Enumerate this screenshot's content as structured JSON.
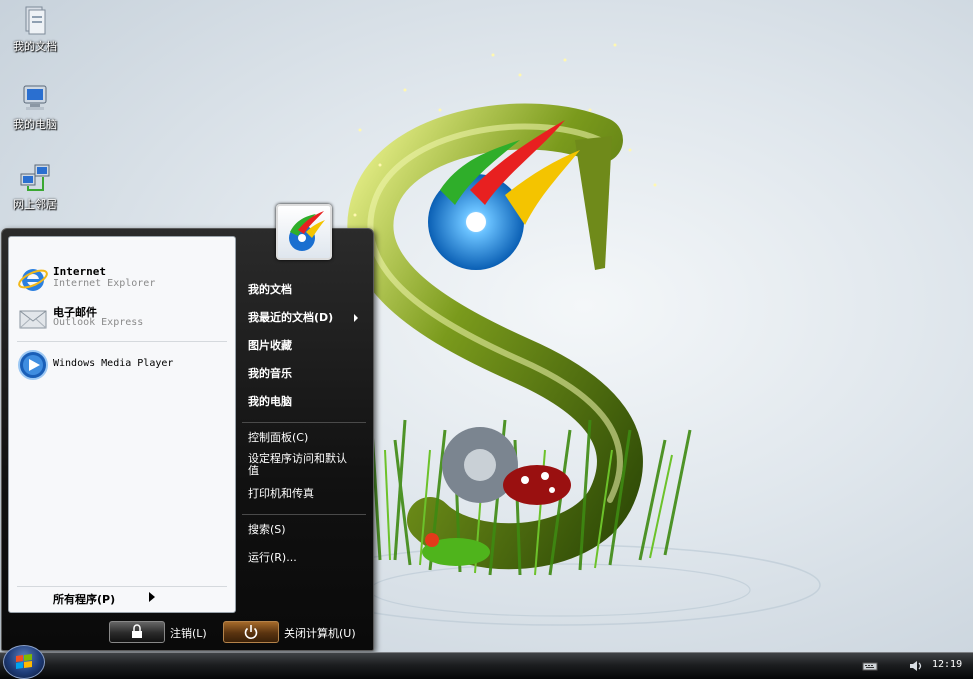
{
  "desktop": {
    "icons": [
      {
        "label": "我的文档",
        "icon": "documents-folder-icon"
      },
      {
        "label": "我的电脑",
        "icon": "computer-icon"
      },
      {
        "label": "网上邻居",
        "icon": "network-icon"
      }
    ]
  },
  "start_menu": {
    "pinned": [
      {
        "title": "Internet",
        "subtitle": "Internet Explorer",
        "icon": "internet-explorer-icon"
      },
      {
        "title": "电子邮件",
        "subtitle": "Outlook Express",
        "icon": "mail-icon"
      }
    ],
    "recent": [
      {
        "title": "Windows Media Player",
        "icon": "media-player-icon"
      }
    ],
    "all_programs": "所有程序(P)",
    "right_items": [
      {
        "label": "我的文档",
        "bold": true
      },
      {
        "label": "我最近的文档(D)",
        "bold": true,
        "submenu": true
      },
      {
        "label": "图片收藏",
        "bold": true
      },
      {
        "label": "我的音乐",
        "bold": true
      },
      {
        "label": "我的电脑",
        "bold": true
      },
      {
        "label": "控制面板(C)",
        "bold": false
      },
      {
        "label": "设定程序访问和默认值",
        "bold": false
      },
      {
        "label": "打印机和传真",
        "bold": false
      },
      {
        "label": "搜索(S)",
        "bold": false
      },
      {
        "label": "运行(R)...",
        "bold": false
      }
    ],
    "log_off_label": "注销(L)",
    "shutdown_label": "关闭计算机(U)"
  },
  "taskbar": {
    "clock": "12:19"
  },
  "colors": {
    "menu_dark": "#111111",
    "left_pane": "#f7f8fa",
    "power_button": "#a56a2a"
  }
}
